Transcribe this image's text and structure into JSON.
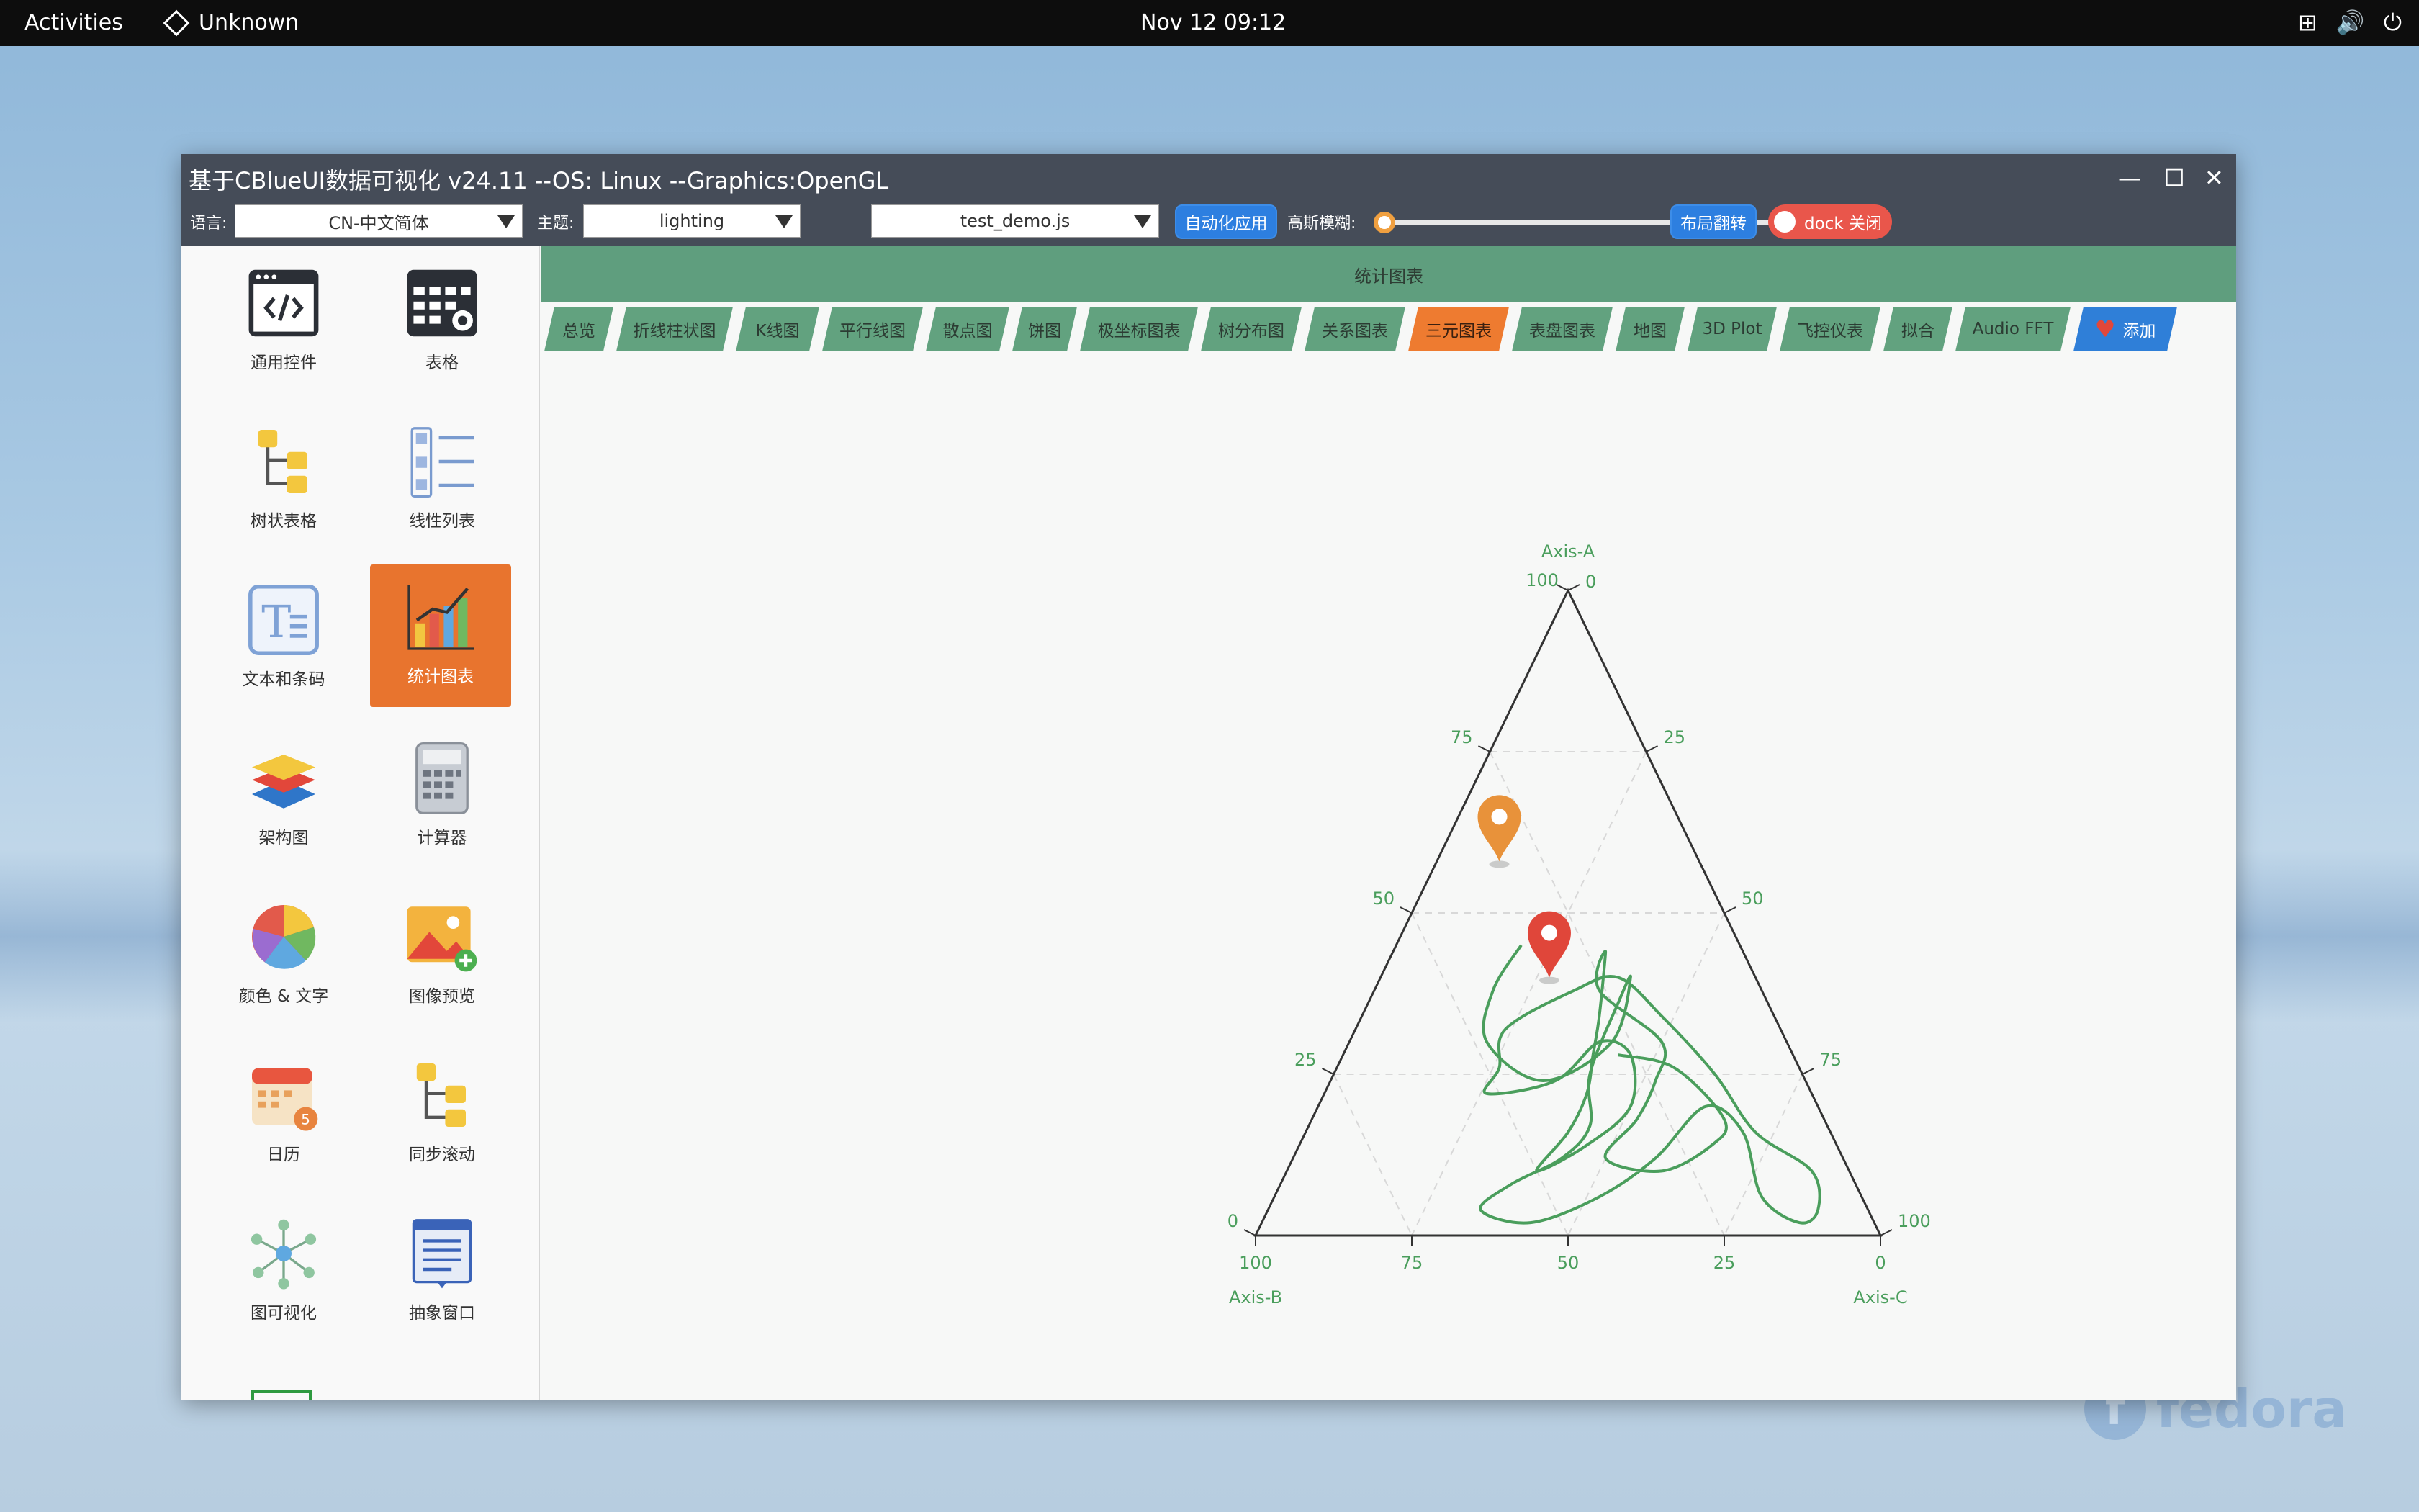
{
  "topbar": {
    "activities": "Activities",
    "app_name": "Unknown",
    "clock": "Nov 12  09:12"
  },
  "window": {
    "title": "基于CBlueUI数据可视化  v24.11  --OS: Linux  --Graphics:OpenGL",
    "lang_label": "语言:",
    "lang_value": "CN-中文简体",
    "theme_label": "主题:",
    "theme_value": "lighting",
    "script_value": "test_demo.js",
    "auto_apply": "自动化应用",
    "blur_label": "高斯模糊:",
    "blur_level": 0.0,
    "layout_flip": "布局翻转",
    "dock_toggle": "dock 关闭"
  },
  "sidebar": {
    "items": [
      {
        "label": "通用控件",
        "icon": "code-window-icon"
      },
      {
        "label": "表格",
        "icon": "table-settings-icon"
      },
      {
        "label": "树状表格",
        "icon": "tree-table-icon"
      },
      {
        "label": "线性列表",
        "icon": "linear-list-icon"
      },
      {
        "label": "文本和条码",
        "icon": "text-icon"
      },
      {
        "label": "统计图表",
        "icon": "bar-chart-icon",
        "active": true
      },
      {
        "label": "架构图",
        "icon": "layers-icon"
      },
      {
        "label": "计算器",
        "icon": "calculator-icon"
      },
      {
        "label": "颜色 & 文字",
        "icon": "color-wheel-icon"
      },
      {
        "label": "图像预览",
        "icon": "image-preview-icon"
      },
      {
        "label": "日历",
        "icon": "calendar-icon"
      },
      {
        "label": "同步滚动",
        "icon": "sync-scroll-icon"
      },
      {
        "label": "图可视化",
        "icon": "graph-icon"
      },
      {
        "label": "抽象窗口",
        "icon": "abstract-window-icon"
      }
    ]
  },
  "content": {
    "header": "统计图表",
    "tabs": [
      "总览",
      "折线柱状图",
      "K线图",
      "平行线图",
      "散点图",
      "饼图",
      "极坐标图表",
      "树分布图",
      "关系图表",
      "三元图表",
      "表盘图表",
      "地图",
      "3D Plot",
      "飞控仪表",
      "拟合",
      "Audio FFT"
    ],
    "active_tab": "三元图表",
    "add_tab": "添加"
  },
  "colors": {
    "tab_green": "#62a27f",
    "tab_active": "#ee7b30",
    "accent_blue": "#2d7fe0",
    "curve": "#4a9e5c",
    "marker_orange": "#e8923a",
    "marker_red": "#e0463a"
  },
  "chart_data": {
    "type": "ternary",
    "axes": {
      "a": "Axis-A",
      "b": "Axis-B",
      "c": "Axis-C"
    },
    "ticks": [
      "0",
      "25",
      "50",
      "75",
      "100"
    ],
    "markers": [
      {
        "color": "orange",
        "a": 58,
        "b": 32,
        "c": 10
      },
      {
        "color": "red",
        "a": 40,
        "b": 33,
        "c": 27
      }
    ],
    "curve": [
      [
        45,
        35,
        20
      ],
      [
        38,
        43,
        19
      ],
      [
        30,
        48,
        22
      ],
      [
        24,
        42,
        34
      ],
      [
        30,
        28,
        42
      ],
      [
        40,
        20,
        40
      ],
      [
        36,
        24,
        40
      ],
      [
        25,
        34,
        41
      ],
      [
        17,
        38,
        45
      ],
      [
        12,
        45,
        43
      ],
      [
        8,
        55,
        37
      ],
      [
        4,
        62,
        34
      ],
      [
        2,
        55,
        43
      ],
      [
        6,
        42,
        52
      ],
      [
        12,
        30,
        58
      ],
      [
        20,
        18,
        62
      ],
      [
        16,
        14,
        70
      ],
      [
        6,
        16,
        78
      ],
      [
        2,
        12,
        86
      ],
      [
        4,
        8,
        88
      ],
      [
        10,
        6,
        84
      ],
      [
        16,
        12,
        72
      ],
      [
        25,
        14,
        61
      ],
      [
        34,
        18,
        48
      ],
      [
        40,
        22,
        38
      ],
      [
        38,
        30,
        32
      ],
      [
        32,
        44,
        24
      ],
      [
        26,
        48,
        26
      ],
      [
        22,
        52,
        26
      ],
      [
        24,
        40,
        36
      ],
      [
        30,
        30,
        40
      ],
      [
        28,
        26,
        46
      ],
      [
        20,
        30,
        50
      ],
      [
        14,
        40,
        46
      ],
      [
        10,
        50,
        40
      ],
      [
        16,
        42,
        42
      ],
      [
        22,
        36,
        42
      ],
      [
        28,
        32,
        40
      ],
      [
        34,
        28,
        38
      ],
      [
        44,
        22,
        34
      ],
      [
        38,
        26,
        36
      ],
      [
        30,
        20,
        50
      ],
      [
        24,
        24,
        52
      ],
      [
        18,
        30,
        52
      ],
      [
        12,
        38,
        50
      ],
      [
        10,
        30,
        60
      ],
      [
        14,
        20,
        66
      ],
      [
        18,
        16,
        66
      ],
      [
        26,
        20,
        54
      ],
      [
        28,
        28,
        44
      ]
    ]
  }
}
